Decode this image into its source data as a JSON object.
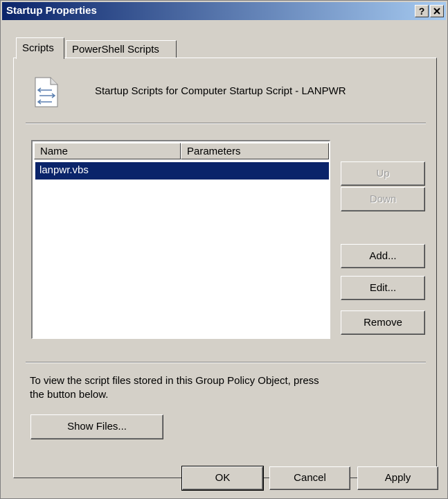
{
  "window": {
    "title": "Startup Properties",
    "help_button": "?",
    "close_button": "✕"
  },
  "tabs": [
    {
      "label": "Scripts",
      "selected": true
    },
    {
      "label": "PowerShell Scripts",
      "selected": false
    }
  ],
  "scripts_tab": {
    "heading": "Startup Scripts for Computer Startup Script - LANPWR",
    "icon": "script-file-icon",
    "list": {
      "columns": [
        "Name",
        "Parameters"
      ],
      "rows": [
        {
          "name": "lanpwr.vbs",
          "parameters": "",
          "selected": true
        }
      ]
    },
    "buttons": {
      "up": "Up",
      "down": "Down",
      "add": "Add...",
      "edit": "Edit...",
      "remove": "Remove"
    },
    "info_text_line1": "To view the script files stored in this Group Policy Object, press",
    "info_text_line2": "the button below.",
    "show_files": "Show Files..."
  },
  "footer": {
    "ok": "OK",
    "cancel": "Cancel",
    "apply": "Apply"
  },
  "colors": {
    "dialog_face": "#d4d0c8",
    "title_gradient_start": "#0a246a",
    "title_gradient_end": "#a6caf0",
    "selection": "#0a246a"
  }
}
